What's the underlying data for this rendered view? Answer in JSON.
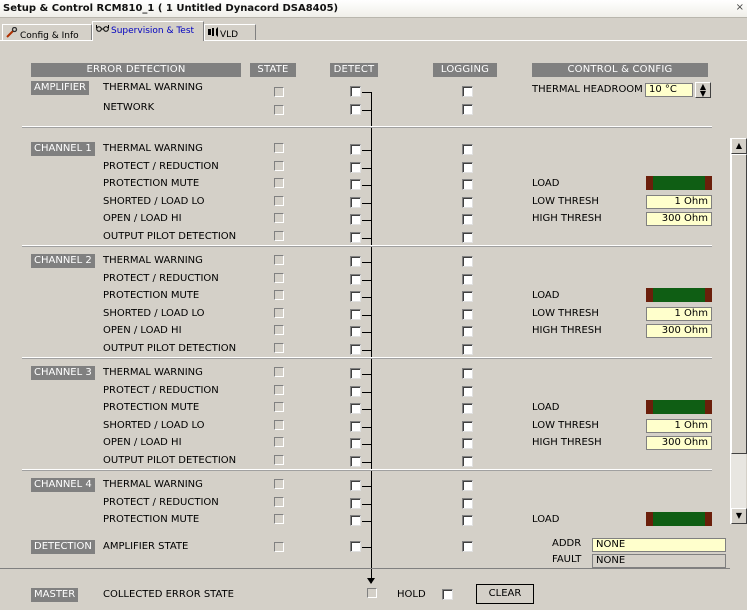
{
  "window": {
    "title": "Setup & Control RCM810_1 ( 1 Untitled Dynacord DSA8405)",
    "close_glyph": "×"
  },
  "tabs": [
    {
      "label": "Config & Info",
      "icon": "wrench-icon"
    },
    {
      "label": "Supervision & Test",
      "icon": "glasses-icon"
    },
    {
      "label": "VLD",
      "icon": "speaker-icon"
    }
  ],
  "headers": {
    "error_detection": "ERROR DETECTION",
    "state": "STATE",
    "detect": "DETECT",
    "logging": "LOGGING",
    "control_config": "CONTROL & CONFIG"
  },
  "amplifier": {
    "tag": "AMPLIFIER",
    "rows": [
      "THERMAL WARNING",
      "NETWORK"
    ],
    "thermal_headroom_label": "THERMAL HEADROOM",
    "thermal_headroom_value": "10 °C"
  },
  "channel_rows": [
    "THERMAL WARNING",
    "PROTECT / REDUCTION",
    "PROTECTION MUTE",
    "SHORTED / LOAD LO",
    "OPEN / LOAD HI",
    "OUTPUT PILOT DETECTION"
  ],
  "channels": [
    {
      "tag": "CHANNEL 1",
      "load": "LOAD",
      "low_label": "LOW THRESH",
      "low": "1 Ohm",
      "high_label": "HIGH THRESH",
      "high": "300 Ohm"
    },
    {
      "tag": "CHANNEL 2",
      "load": "LOAD",
      "low_label": "LOW THRESH",
      "low": "1 Ohm",
      "high_label": "HIGH THRESH",
      "high": "300 Ohm"
    },
    {
      "tag": "CHANNEL 3",
      "load": "LOAD",
      "low_label": "LOW THRESH",
      "low": "1 Ohm",
      "high_label": "HIGH THRESH",
      "high": "300 Ohm"
    },
    {
      "tag": "CHANNEL 4",
      "load": "LOAD"
    }
  ],
  "detection": {
    "tag": "DETECTION",
    "row": "AMPLIFIER STATE",
    "addr_label": "ADDR",
    "addr_value": "NONE",
    "fault_label": "FAULT",
    "fault_value": "NONE"
  },
  "master": {
    "tag": "MASTER",
    "row": "COLLECTED ERROR STATE",
    "hold_label": "HOLD",
    "clear_label": "CLEAR"
  },
  "colors": {
    "tag_bg": "#808080",
    "load_green": "#0f5e14",
    "load_red": "#6b1f0b",
    "field_bg": "#ffffcc"
  }
}
